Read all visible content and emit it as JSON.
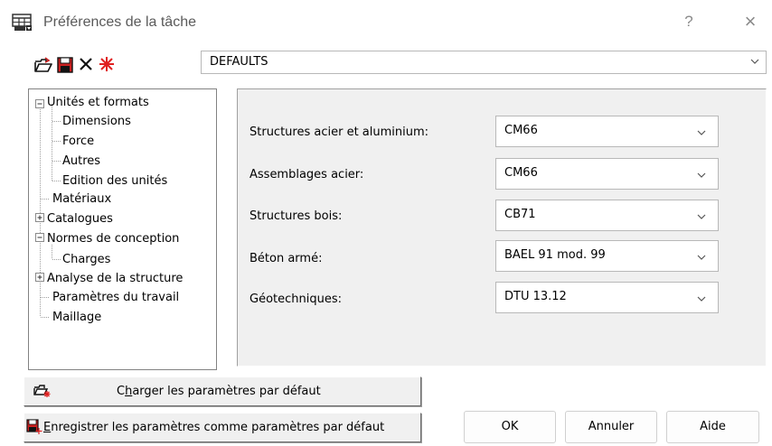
{
  "window": {
    "title": "Préférences de la tâche",
    "help_label": "?",
    "close_label": "×"
  },
  "toolbar": {
    "icons": [
      "open-folder-icon",
      "save-disk-icon",
      "delete-x-icon",
      "reset-star-icon"
    ],
    "delete_glyph": "✕"
  },
  "preset": {
    "value": "DEFAULTS"
  },
  "tree": {
    "items": [
      {
        "label": "Unités et formats",
        "expander": "−"
      },
      {
        "label": "Dimensions"
      },
      {
        "label": "Force"
      },
      {
        "label": "Autres"
      },
      {
        "label": "Edition des unités"
      },
      {
        "label": "Matériaux"
      },
      {
        "label": "Catalogues",
        "expander": "+"
      },
      {
        "label": "Normes de conception",
        "expander": "−"
      },
      {
        "label": "Charges"
      },
      {
        "label": "Analyse de la structure",
        "expander": "+"
      },
      {
        "label": "Paramètres du travail"
      },
      {
        "label": "Maillage"
      }
    ]
  },
  "form": {
    "fields": [
      {
        "label": "Structures acier et aluminium:",
        "value": "CM66"
      },
      {
        "label": "Assemblages acier:",
        "value": "CM66"
      },
      {
        "label": "Structures bois:",
        "value": "CB71"
      },
      {
        "label": "Béton armé:",
        "value": "BAEL 91 mod. 99"
      },
      {
        "label": "Géotechniques:",
        "value": "DTU 13.12"
      }
    ]
  },
  "buttons": {
    "load_defaults_pre": "C",
    "load_defaults_accel": "h",
    "load_defaults_post": "arger les paramètres par défaut",
    "save_defaults_accel": "E",
    "save_defaults_post": "nregistrer les paramètres comme paramètres par défaut",
    "ok": "OK",
    "cancel": "Annuler",
    "help": "Aide"
  },
  "colors": {
    "accent_red": "#cc1f1f",
    "tree_line": "#a0a0a0",
    "panel_bg": "#f0f0f0"
  }
}
